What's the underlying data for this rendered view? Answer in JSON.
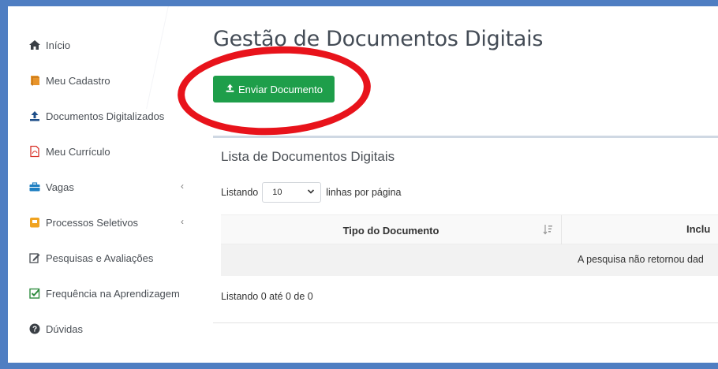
{
  "sidebar": {
    "items": [
      {
        "label": "Início",
        "icon": "home-icon"
      },
      {
        "label": "Meu Cadastro",
        "icon": "book-icon"
      },
      {
        "label": "Documentos Digitalizados",
        "icon": "upload-icon"
      },
      {
        "label": "Meu Currículo",
        "icon": "pdf-file-icon"
      },
      {
        "label": "Vagas",
        "icon": "briefcase-icon",
        "chevron": "‹"
      },
      {
        "label": "Processos Seletivos",
        "icon": "clipboard-icon",
        "chevron": "‹"
      },
      {
        "label": "Pesquisas e Avaliações",
        "icon": "edit-icon"
      },
      {
        "label": "Frequência na Aprendizagem",
        "icon": "check-square-icon"
      },
      {
        "label": "Dúvidas",
        "icon": "question-circle-icon"
      }
    ]
  },
  "main": {
    "title": "Gestão de Documentos Digitais",
    "send_button_label": "Enviar Documento",
    "card": {
      "title": "Lista de Documentos Digitais",
      "length_prefix": "Listando",
      "length_value": "10",
      "length_suffix": "linhas por página",
      "columns": [
        "Tipo do Documento",
        "Inclu"
      ],
      "empty_message": "A pesquisa não retornou dad",
      "info": "Listando 0 até 0 de 0"
    }
  },
  "colors": {
    "accent_green": "#1e9e4a",
    "highlight_red": "#e8131b",
    "frame_blue": "#4f7ec2"
  }
}
